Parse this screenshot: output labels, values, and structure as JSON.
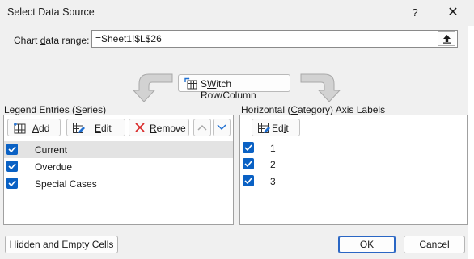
{
  "dialog": {
    "title": "Select Data Source",
    "help_label": "?",
    "close_label": "✕"
  },
  "range": {
    "label_pre": "Chart ",
    "label_key": "d",
    "label_post": "ata range:",
    "value": "=Sheet1!$L$26"
  },
  "switch_button": {
    "key": "W",
    "label_post": "itch Row/Column",
    "label_pre": "S"
  },
  "legend": {
    "label_pre": "Legend Entries (",
    "label_key": "S",
    "label_post": "eries)",
    "add": {
      "key": "A",
      "post": "dd"
    },
    "edit": {
      "key": "E",
      "post": "dit"
    },
    "remove": {
      "key": "R",
      "post": "emove"
    },
    "series": [
      {
        "label": "Current",
        "checked": true,
        "selected": true
      },
      {
        "label": "Overdue",
        "checked": true,
        "selected": false
      },
      {
        "label": "Special Cases",
        "checked": true,
        "selected": false
      }
    ]
  },
  "axis": {
    "label_pre": "Horizontal (",
    "label_key": "C",
    "label_post": "ategory) Axis Labels",
    "edit": {
      "pre": "Ed",
      "key": "i",
      "post": "t"
    },
    "categories": [
      {
        "label": "1",
        "checked": true
      },
      {
        "label": "2",
        "checked": true
      },
      {
        "label": "3",
        "checked": true
      }
    ]
  },
  "footer": {
    "hidden_empty": {
      "key": "H",
      "post": "idden and Empty Cells"
    },
    "ok_label": "OK",
    "cancel_label": "Cancel"
  },
  "colors": {
    "checkbox": "#0a61c4",
    "remove_icon": "#d92b2b",
    "selected_row": "#e3e3e3"
  }
}
